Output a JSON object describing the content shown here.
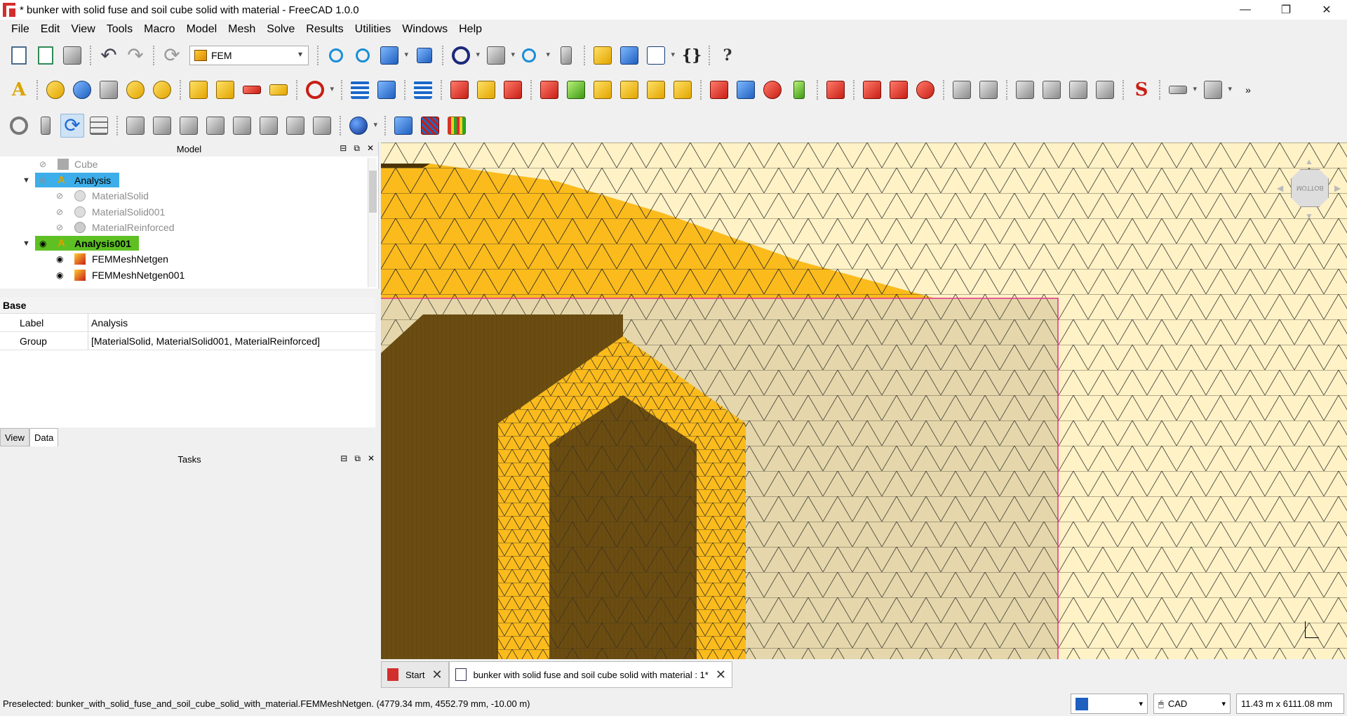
{
  "window": {
    "title": "* bunker with solid fuse and soil cube solid with material - FreeCAD 1.0.0",
    "minimize": "—",
    "maximize": "❐",
    "close": "✕"
  },
  "menu": [
    "File",
    "Edit",
    "View",
    "Tools",
    "Macro",
    "Model",
    "Mesh",
    "Solve",
    "Results",
    "Utilities",
    "Windows",
    "Help"
  ],
  "toolbar": {
    "workbench": "FEM"
  },
  "model_panel": {
    "title": "Model",
    "tree": [
      {
        "label": "Cube",
        "visible": false
      },
      {
        "label": "Analysis",
        "selected": "blue"
      },
      {
        "label": "MaterialSolid"
      },
      {
        "label": "MaterialSolid001"
      },
      {
        "label": "MaterialReinforced"
      },
      {
        "label": "Analysis001",
        "selected": "green"
      },
      {
        "label": "FEMMeshNetgen"
      },
      {
        "label": "FEMMeshNetgen001"
      }
    ]
  },
  "properties": {
    "group": "Base",
    "rows": [
      {
        "key": "Label",
        "value": "Analysis"
      },
      {
        "key": "Group",
        "value": "[MaterialSolid, MaterialSolid001, MaterialReinforced]"
      }
    ],
    "tabs": [
      "View",
      "Data"
    ]
  },
  "tasks_panel": {
    "title": "Tasks"
  },
  "doc_tabs": [
    {
      "label": "Start"
    },
    {
      "label": "bunker with solid fuse and soil cube solid with material : 1*"
    }
  ],
  "status": {
    "text": "Preselected: bunker_with_solid_fuse_and_soil_cube_solid_with_material.FEMMeshNetgen. (4779.34 mm, 4552.79 mm, -10.00 m)",
    "nav_style": "CAD",
    "dimensions": "11.43 m x 6111.08 mm"
  },
  "navcube": {
    "face": "BOTTOM"
  },
  "colors": {
    "selection_blue": "#3daee9",
    "selection_green": "#5ec023",
    "mesh_yellow": "#fbbb1c",
    "mesh_dark": "#6b4d12",
    "soil_light": "#fff3c8"
  }
}
